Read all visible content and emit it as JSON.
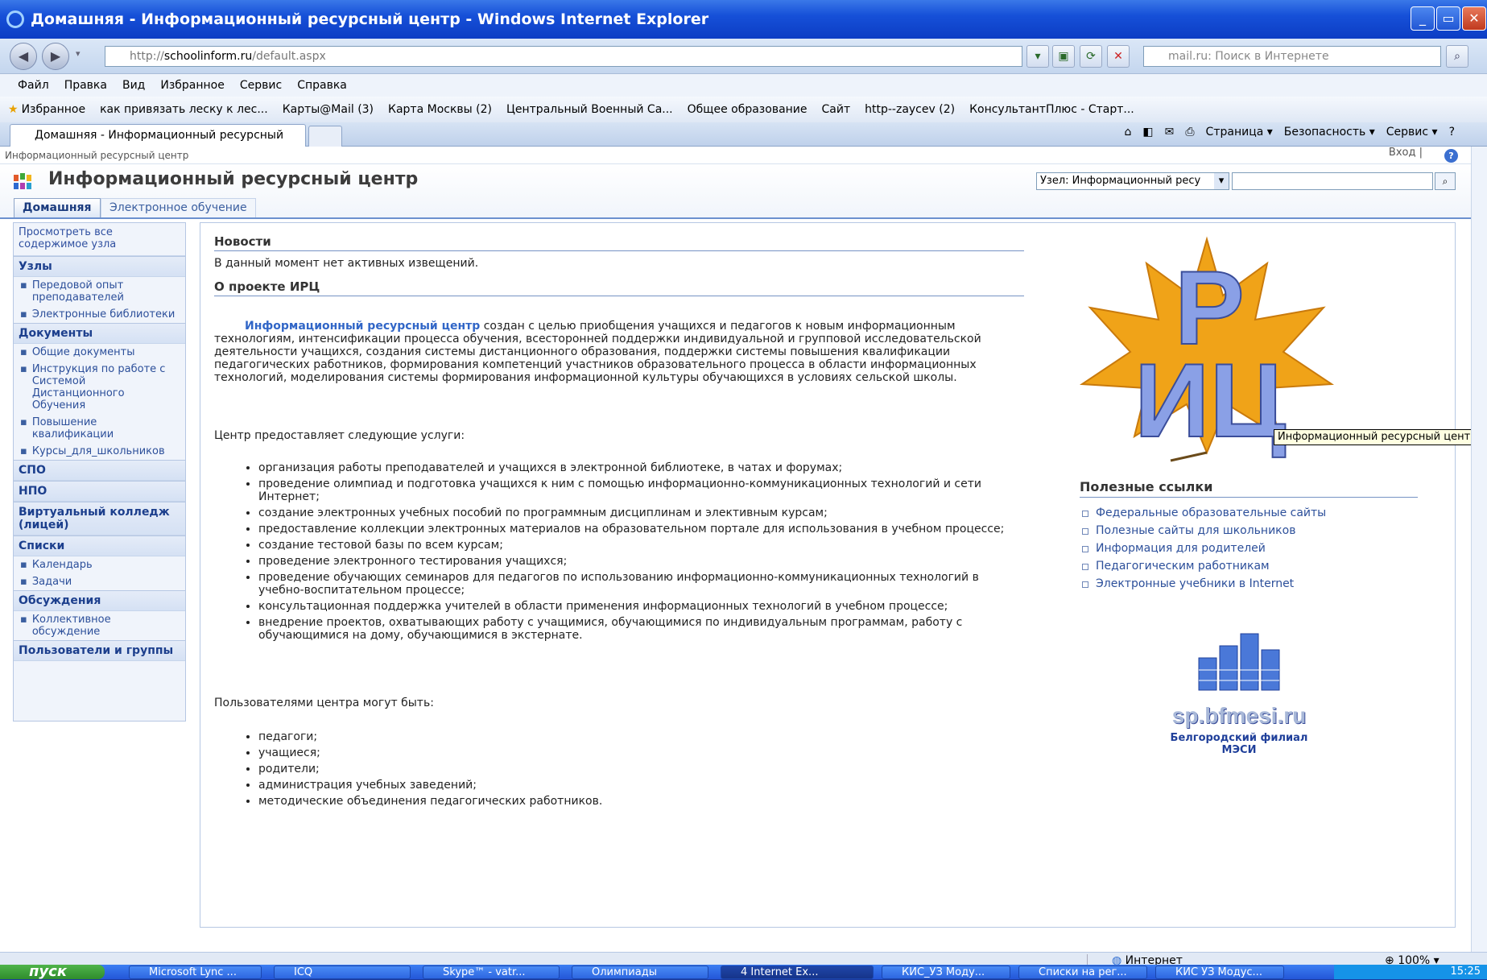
{
  "window": {
    "title": "Домашняя - Информационный ресурсный центр - Windows Internet Explorer",
    "minimize": "_",
    "maximize": "▭",
    "close": "✕"
  },
  "address": {
    "scheme": "http://",
    "host": "schoolinform.ru",
    "path": "/default.aspx",
    "search_placeholder": "mail.ru: Поиск в Интернете"
  },
  "menu": [
    "Файл",
    "Правка",
    "Вид",
    "Избранное",
    "Сервис",
    "Справка"
  ],
  "favorites": {
    "label": "Избранное",
    "items": [
      "как привязать леску к лес...",
      "Карты@Mail (3)",
      "Карта Москвы (2)",
      "Центральный Военный Са...",
      "Общее образование",
      "Сайт",
      "http--zaycev (2)",
      "КонсультантПлюс - Старт..."
    ]
  },
  "tab": {
    "title": "Домашняя - Информационный ресурсный центр"
  },
  "commands": [
    "Страница ▾",
    "Безопасность ▾",
    "Сервис ▾"
  ],
  "breadcrumb": "Информационный ресурсный центр",
  "login": "Вход |",
  "site": {
    "title": "Информационный ресурсный центр",
    "scope": "Узел: Информационный ресу",
    "tabs": [
      "Домашняя",
      "Электронное обучение"
    ]
  },
  "quicklaunch": {
    "view_all": "Просмотреть все содержимое узла",
    "sections": [
      {
        "title": "Узлы",
        "items": [
          "Передовой опыт преподавателей",
          "Электронные библиотеки"
        ]
      },
      {
        "title": "Документы",
        "items": [
          "Общие документы",
          "Инструкция по работе с Системой Дистанционного Обучения",
          "Повышение квалификации",
          "Курсы_для_школьников"
        ]
      },
      {
        "title": "СПО",
        "items": []
      },
      {
        "title": "НПО",
        "items": []
      },
      {
        "title": "Виртуальный колледж (лицей)",
        "items": []
      },
      {
        "title": "Списки",
        "items": [
          "Календарь",
          "Задачи"
        ]
      },
      {
        "title": "Обсуждения",
        "items": [
          "Коллективное обсуждение"
        ]
      },
      {
        "title": "Пользователи и группы",
        "items": []
      }
    ]
  },
  "news": {
    "title": "Новости",
    "empty": "В данный момент нет активных извещений."
  },
  "about": {
    "title": "О проекте ИРЦ",
    "lead": "Информационный ресурсный центр",
    "text": " создан с целью приобщения учащихся и педагогов к новым информационным технологиям, интенсификации процесса обучения, всесторонней поддержки индивидуальной и групповой исследовательской деятельности учащихся, создания системы дистанционного образования, поддержки системы повышения квалификации педагогических работников, формирования компетенций участников образовательного процесса в области информационных технологий, моделирования системы формирования информационной культуры обучающихся в условиях сельской школы.",
    "services_intro": "Центр предоставляет следующие услуги:",
    "services": [
      "организация работы преподавателей и учащихся в электронной библиотеке, в чатах и форумах;",
      "проведение олимпиад  и подготовка учащихся к ним с помощью информационно-коммуникационных технологий и сети Интернет;",
      "создание электронных учебных пособий по программным дисциплинам и элективным курсам;",
      "предоставление коллекции электронных материалов на образовательном портале для использования в учебном процессе;",
      "создание тестовой базы по всем курсам;",
      "проведение электронного тестирования учащихся;",
      "проведение обучающих семинаров для педагогов по использованию информационно-коммуникационных технологий в учебно-воспитательном процессе;",
      "консультационная поддержка учителей в области применения информационных технологий в учебном процессе;",
      "внедрение проектов, охватывающих работу с учащимися, обучающимися по индивидуальным программам, работу с обучающимися на дому, обучающимися в экстернате."
    ],
    "users_intro": "Пользователями центра могут быть:",
    "users": [
      "педагоги;",
      "учащиеся;",
      "родители;",
      "администрация учебных заведений;",
      "методические объединения педагогических работников."
    ]
  },
  "logo": {
    "letters_top": "Р",
    "letters_bottom": "ИЦ",
    "tooltip": "Информационный ресурсный центр"
  },
  "useful_links": {
    "title": "Полезные ссылки",
    "items": [
      "Федеральные образовательные сайты",
      "Полезные сайты для школьников",
      "Информация для родителей",
      "Педагогическим работникам",
      "Электронные учебники в Internet"
    ]
  },
  "partner": {
    "url": "sp.bfmesi.ru",
    "caption1": "Белгородский филиал",
    "caption2": "МЭСИ"
  },
  "status": {
    "zone": "Интернет",
    "zoom": "100%"
  },
  "taskbar": {
    "start": "пуск",
    "tasks": [
      "Microsoft Lync ...",
      "ICQ",
      "Skype™ - vatr...",
      "Олимпиады",
      "4 Internet Ex...",
      "КИС_УЗ Моду...",
      "Списки на рег...",
      "КИС УЗ Модус..."
    ],
    "clock": "15:25"
  },
  "colors": {
    "accent": "#3166c7",
    "title_bar": "#1650d8"
  }
}
